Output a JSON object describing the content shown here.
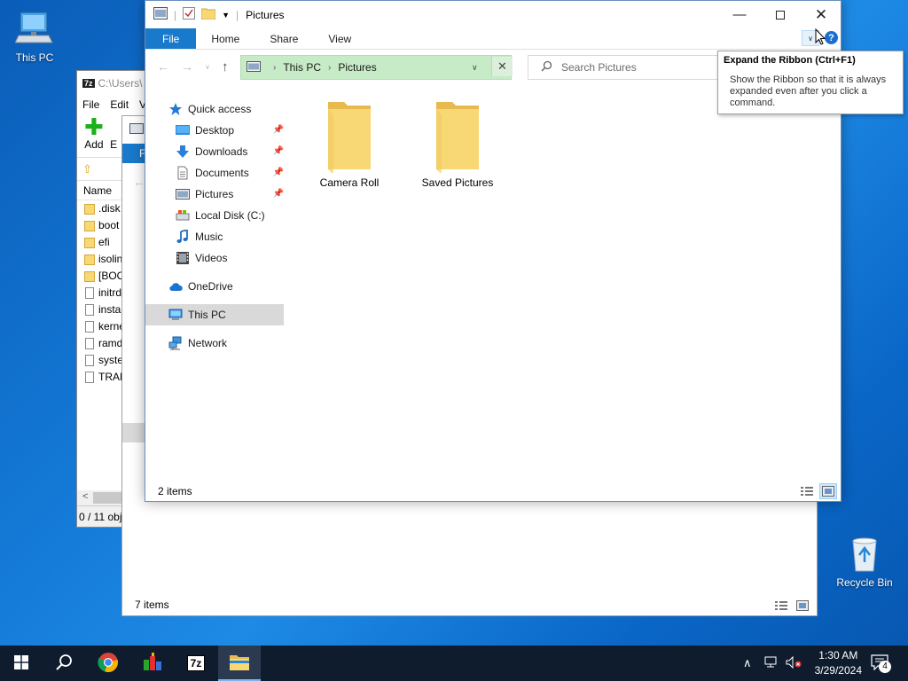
{
  "desktop": {
    "this_pc_label": "This PC",
    "recycle_bin_label": "Recycle Bin"
  },
  "sevenzip": {
    "title": "C:\\Users\\",
    "menu": [
      "File",
      "Edit",
      "V"
    ],
    "add_label": "Add",
    "extract_label": "E",
    "column_name": "Name",
    "files": [
      ".disk",
      "boot",
      "efi",
      "isolin",
      "[BOO",
      "initrd",
      "instal",
      "kerne",
      "ramd",
      "syster",
      "TRAN"
    ],
    "status": "0 / 11 obj"
  },
  "explorer_back": {
    "file_tab": "F",
    "status": "7 items"
  },
  "explorer": {
    "title": "Pictures",
    "tabs": {
      "file": "File",
      "home": "Home",
      "share": "Share",
      "view": "View"
    },
    "breadcrumb": [
      "This PC",
      "Pictures"
    ],
    "search_placeholder": "Search Pictures",
    "nav": {
      "quick_access": "Quick access",
      "desktop": "Desktop",
      "downloads": "Downloads",
      "documents": "Documents",
      "pictures": "Pictures",
      "local_disk": "Local Disk (C:)",
      "music": "Music",
      "videos": "Videos",
      "onedrive": "OneDrive",
      "this_pc": "This PC",
      "network": "Network"
    },
    "folders": [
      "Camera Roll",
      "Saved Pictures"
    ],
    "status": "2 items"
  },
  "tooltip": {
    "title": "Expand the Ribbon (Ctrl+F1)",
    "body": "Show the Ribbon so that it is always expanded even after you click a command."
  },
  "taskbar": {
    "time": "1:30 AM",
    "date": "3/29/2024",
    "notification_count": "4",
    "sevenzip_label": "7z"
  },
  "colors": {
    "file_tab": "#1979ca",
    "address_bar": "#c6ebc6",
    "taskbar": "#0f1c2e",
    "folder": "#f8d775"
  }
}
